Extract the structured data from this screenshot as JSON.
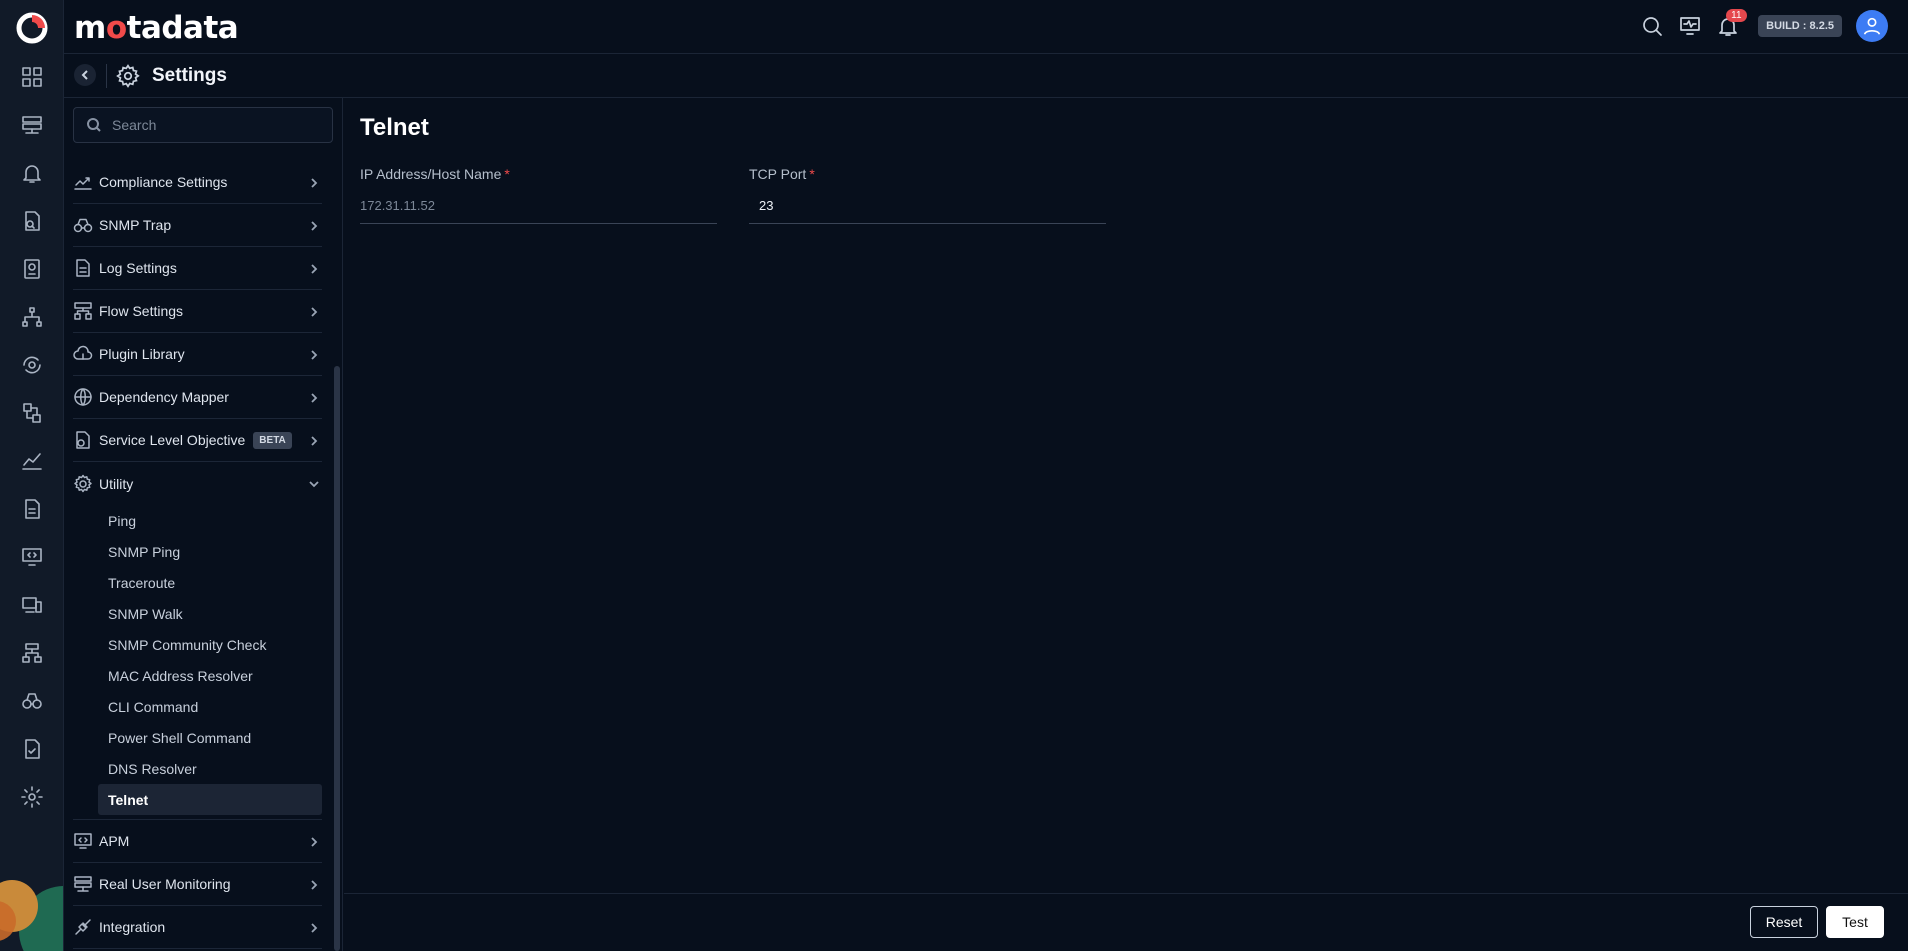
{
  "app": {
    "brand": "motadata",
    "build": "BUILD : 8.2.5",
    "notification_count": "11"
  },
  "rail": {
    "icons": [
      "dashboard-icon",
      "server-icon",
      "bell-icon",
      "log-search-icon",
      "document-icon",
      "topology-icon",
      "monitor-refresh-icon",
      "transfer-icon",
      "chart-line-icon",
      "file-icon",
      "code-monitor-icon",
      "device-icon",
      "network-icon",
      "binoculars-icon",
      "checklist-icon",
      "gear-icon"
    ]
  },
  "header": {
    "title": "Settings"
  },
  "sidebar": {
    "search_placeholder": "Search",
    "items": [
      {
        "label": "Compliance Settings",
        "icon": "compliance-icon"
      },
      {
        "label": "SNMP Trap",
        "icon": "binoculars-icon"
      },
      {
        "label": "Log Settings",
        "icon": "log-file-icon"
      },
      {
        "label": "Flow Settings",
        "icon": "flow-icon"
      },
      {
        "label": "Plugin Library",
        "icon": "cloud-plugin-icon"
      },
      {
        "label": "Dependency Mapper",
        "icon": "globe-icon"
      },
      {
        "label": "Service Level Objective",
        "icon": "slo-icon",
        "badge": "BETA"
      },
      {
        "label": "Utility",
        "icon": "utility-gear-icon",
        "expanded": true
      }
    ],
    "utility_sub_items": [
      "Ping",
      "SNMP Ping",
      "Traceroute",
      "SNMP Walk",
      "SNMP Community Check",
      "MAC Address Resolver",
      "CLI Command",
      "Power Shell Command",
      "DNS Resolver",
      "Telnet"
    ],
    "active_sub_item": "Telnet",
    "items_after": [
      {
        "label": "APM",
        "icon": "apm-icon"
      },
      {
        "label": "Real User Monitoring",
        "icon": "rum-icon"
      },
      {
        "label": "Integration",
        "icon": "plug-icon"
      }
    ]
  },
  "main": {
    "title": "Telnet",
    "ip_field": {
      "label": "IP Address/Host Name",
      "required_mark": "*",
      "placeholder": "172.31.11.52"
    },
    "port_field": {
      "label": "TCP Port",
      "required_mark": "*",
      "value": "23"
    },
    "reset_label": "Reset",
    "test_label": "Test"
  }
}
